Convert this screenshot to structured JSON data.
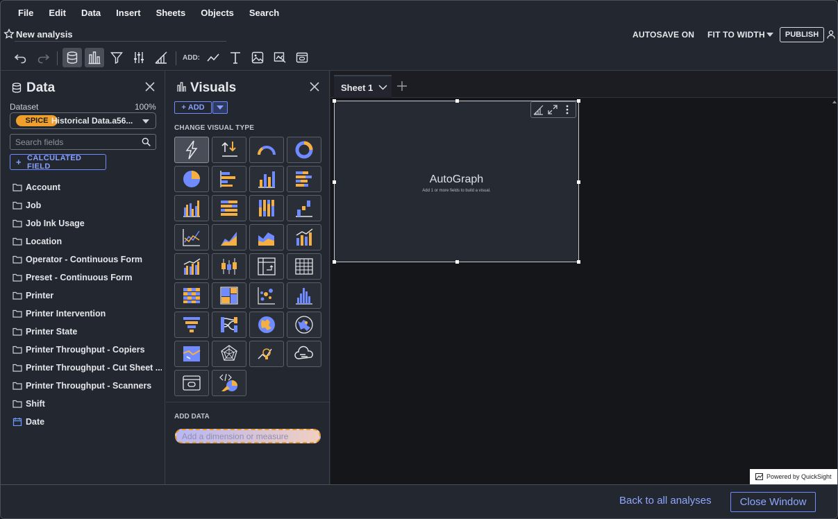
{
  "menu": [
    "File",
    "Edit",
    "Data",
    "Insert",
    "Sheets",
    "Objects",
    "Search"
  ],
  "analysis": {
    "name": "New analysis",
    "autosave": "AUTOSAVE ON",
    "fit": "FIT TO WIDTH",
    "publish": "PUBLISH"
  },
  "toolbar": {
    "add_label": "ADD:"
  },
  "data_panel": {
    "title": "Data",
    "dataset_label": "Dataset",
    "dataset_percent": "100%",
    "spice_badge": "SPICE",
    "dataset_name": "Historical Data.a56...",
    "search_placeholder": "Search fields",
    "calc_label": "CALCULATED FIELD",
    "fields": [
      "Account",
      "Job",
      "Job Ink Usage",
      "Location",
      "Operator - Continuous Form",
      "Preset - Continuous Form",
      "Printer",
      "Printer Intervention",
      "Printer State",
      "Printer Throughput - Copiers",
      "Printer Throughput - Cut Sheet ...",
      "Printer Throughput - Scanners",
      "Shift",
      "Date"
    ]
  },
  "visuals_panel": {
    "title": "Visuals",
    "add_label": "ADD",
    "change_type": "CHANGE VISUAL TYPE",
    "add_data": "ADD DATA",
    "drop_placeholder": "Add a dimension or measure"
  },
  "sheet": {
    "tab": "Sheet 1",
    "visual_title": "AutoGraph",
    "visual_sub": "Add 1 or more fields to build a visual.",
    "powered": "Powered by QuickSight"
  },
  "footer": {
    "back": "Back to all analyses",
    "close": "Close Window"
  },
  "colors": {
    "accent": "#86a1ff",
    "spice": "#f0a02a",
    "chart_blue": "#6f8bff",
    "chart_orange": "#f5b041"
  }
}
